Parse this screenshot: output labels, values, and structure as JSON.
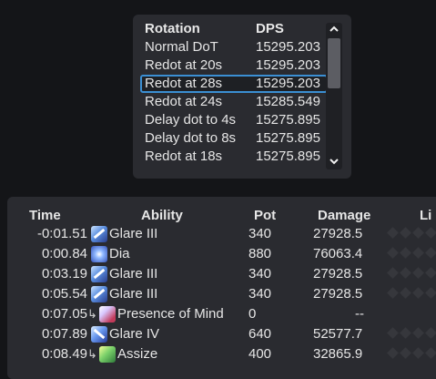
{
  "rotation_panel": {
    "header": {
      "name": "Rotation",
      "dps": "DPS"
    },
    "rows": [
      {
        "name": "Normal DoT",
        "dps": "15295.203"
      },
      {
        "name": "Redot at 20s",
        "dps": "15295.203"
      },
      {
        "name": "Redot at 28s",
        "dps": "15295.203"
      },
      {
        "name": "Redot at 24s",
        "dps": "15285.549"
      },
      {
        "name": "Delay dot to 4s",
        "dps": "15275.895"
      },
      {
        "name": "Delay dot to 8s",
        "dps": "15275.895"
      },
      {
        "name": "Redot at 18s",
        "dps": "15275.895"
      }
    ],
    "selected_index": 2,
    "scroll_up_icon": "chevron-up-icon",
    "scroll_down_icon": "chevron-down-icon"
  },
  "timeline": {
    "headers": {
      "time": "Time",
      "ability": "Ability",
      "pot": "Pot",
      "damage": "Damage",
      "life": "Li"
    },
    "rows": [
      {
        "time": "-0:01.51",
        "ability": "Glare III",
        "icon": "glare-iii-icon",
        "ogcd": false,
        "pot": "340",
        "damage": "27928.5"
      },
      {
        "time": "0:00.84",
        "ability": "Dia",
        "icon": "dia-icon",
        "ogcd": false,
        "pot": "880",
        "damage": "76063.4"
      },
      {
        "time": "0:03.19",
        "ability": "Glare III",
        "icon": "glare-iii-icon",
        "ogcd": false,
        "pot": "340",
        "damage": "27928.5"
      },
      {
        "time": "0:05.54",
        "ability": "Glare III",
        "icon": "glare-iii-icon",
        "ogcd": false,
        "pot": "340",
        "damage": "27928.5"
      },
      {
        "time": "0:07.05",
        "ability": "Presence of Mind",
        "icon": "presence-of-mind-icon",
        "ogcd": true,
        "pot": "0",
        "damage": "--"
      },
      {
        "time": "0:07.89",
        "ability": "Glare IV",
        "icon": "glare-iv-icon",
        "ogcd": false,
        "pot": "640",
        "damage": "52577.7"
      },
      {
        "time": "0:08.49",
        "ability": "Assize",
        "icon": "assize-icon",
        "ogcd": true,
        "pot": "400",
        "damage": "32865.9"
      }
    ]
  },
  "colors": {
    "background": "#141518",
    "panel": "#2a2b30",
    "selection_border": "#3b8fd3",
    "text": "#e6e6e6"
  }
}
